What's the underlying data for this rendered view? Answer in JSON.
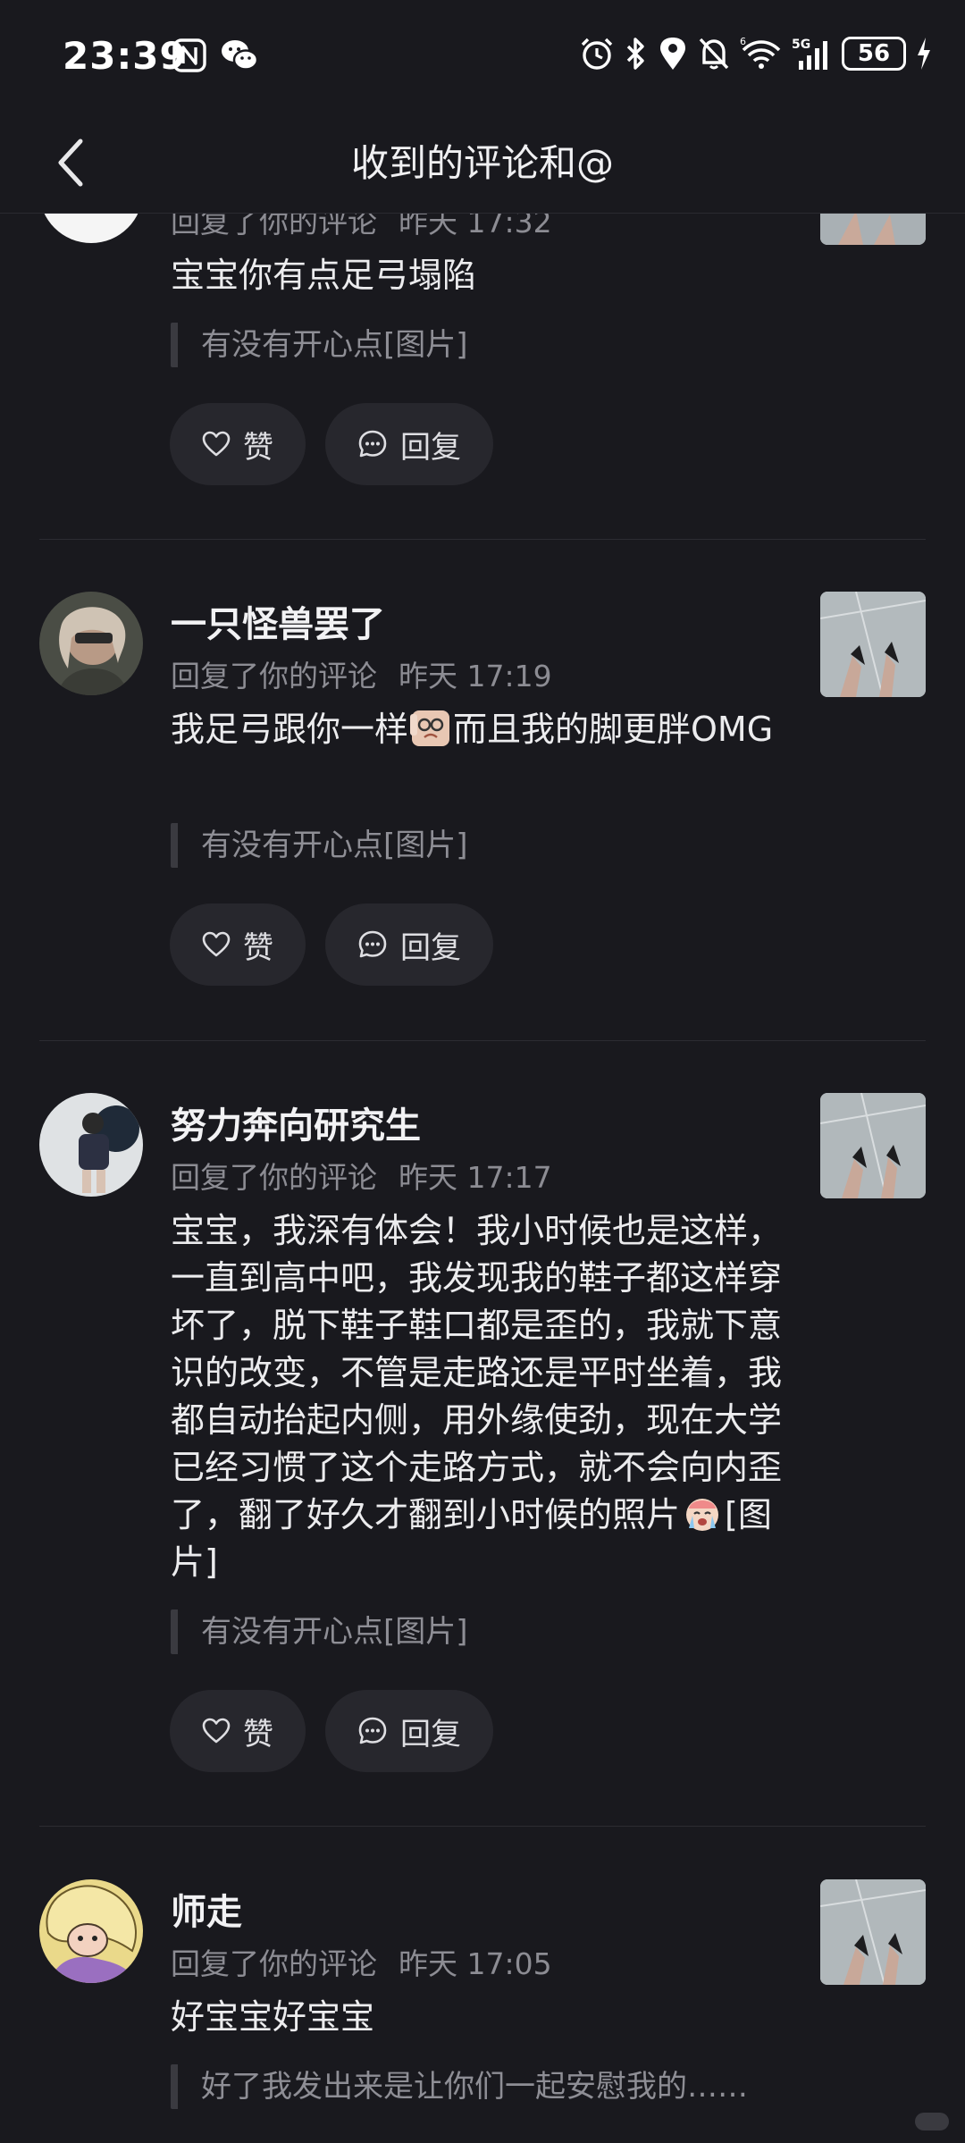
{
  "status_bar": {
    "time": "23:39",
    "battery": "56",
    "left_icons": [
      "nfc-icon",
      "wechat-icon"
    ],
    "right_icons": [
      "alarm-icon",
      "bluetooth-icon",
      "location-icon",
      "mute-bell-icon",
      "wifi-icon",
      "5g-signal-icon",
      "battery-icon",
      "charging-icon"
    ]
  },
  "header": {
    "title": "收到的评论和@",
    "back_icon": "chevron-left-icon"
  },
  "items": [
    {
      "username": "",
      "meta": "回复了你的评论",
      "time": "昨天 17:32",
      "comment": "宝宝你有点足弓塌陷",
      "quote": "有没有开心点[图片]",
      "like_label": "赞",
      "reply_label": "回复"
    },
    {
      "username": "一只怪兽罢了",
      "meta": "回复了你的评论",
      "time": "昨天 17:19",
      "comment_before_emoji": "我足弓跟你一样",
      "comment_after_emoji": "而且我的脚更胖OMG",
      "quote": "有没有开心点[图片]",
      "like_label": "赞",
      "reply_label": "回复"
    },
    {
      "username": "努力奔向研究生",
      "meta": "回复了你的评论",
      "time": "昨天 17:17",
      "comment_before_emoji": "宝宝，我深有体会！我小时候也是这样，一直到高中吧，我发现我的鞋子都这样穿坏了，脱下鞋子鞋口都是歪的，我就下意识的改变，不管是走路还是平时坐着，我都自动抬起内侧，用外缘使劲，现在大学已经习惯了这个走路方式，就不会向内歪了，翻了好久才翻到小时候的照片",
      "comment_after_emoji": "[图片]",
      "quote": "有没有开心点[图片]",
      "like_label": "赞",
      "reply_label": "回复"
    },
    {
      "username": "师走",
      "meta": "回复了你的评论",
      "time": "昨天 17:05",
      "comment": "好宝宝好宝宝",
      "quote": "好了我发出来是让你们一起安慰我的……"
    }
  ],
  "colors": {
    "background": "#19191e",
    "button_bg": "#27272d",
    "secondary_text": "#8c8c93"
  }
}
